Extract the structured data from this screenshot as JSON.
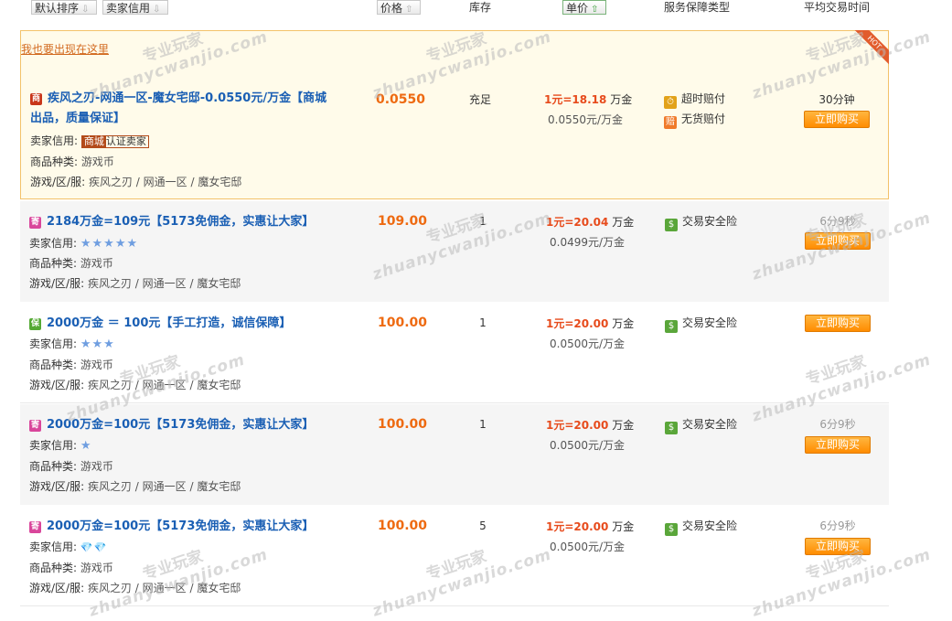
{
  "header": {
    "sort_default": "默认排序",
    "sort_credit": "卖家信用",
    "price": "价格",
    "stock": "库存",
    "unit_price": "单价",
    "service": "服务保障类型",
    "avg_time": "平均交易时间"
  },
  "hot_link": "我也要出现在这里",
  "hot_ribbon": "HOT",
  "watermark": {
    "cn": "专业玩家",
    "en": "zhuanycwanjio.com"
  },
  "labels": {
    "credit": "卖家信用:",
    "category": "商品种类:",
    "server": "游戏/区/服:"
  },
  "rows": [
    {
      "badge": "商",
      "title_line1": "疾风之刃-网通一区-魔女宅邸-0.0550元/万金【商城",
      "title_line2": "出品，质量保证】",
      "credit_cert_a": "商城",
      "credit_cert_b": "认证卖家",
      "category": "游戏币",
      "server": "疾风之刃 / 网通一区 / 魔女宅邸",
      "price": "0.0550",
      "stock": "充足",
      "unit_hi": "1元=18.18",
      "unit_suffix": "万金",
      "unit_sub": "0.0550元/万金",
      "service1": "超时赔付",
      "service2": "无货赔付",
      "time": "30分钟",
      "buy": "立即购买"
    },
    {
      "badge": "寄",
      "title": "2184万金=109元【5173免佣金，实惠让大家】",
      "stars": "★★★★★",
      "category": "游戏币",
      "server": "疾风之刃 / 网通一区 / 魔女宅邸",
      "price": "109.00",
      "stock": "1",
      "unit_hi": "1元=20.04",
      "unit_suffix": "万金",
      "unit_sub": "0.0499元/万金",
      "service1": "交易安全险",
      "time": "6分9秒",
      "buy": "立即购买"
    },
    {
      "badge": "保",
      "title": "2000万金 ＝ 100元【手工打造，诚信保障】",
      "stars": "★★★",
      "category": "游戏币",
      "server": "疾风之刃 / 网通一区 / 魔女宅邸",
      "price": "100.00",
      "stock": "1",
      "unit_hi": "1元=20.00",
      "unit_suffix": "万金",
      "unit_sub": "0.0500元/万金",
      "service1": "交易安全险",
      "buy": "立即购买"
    },
    {
      "badge": "寄",
      "title": "2000万金=100元【5173免佣金，实惠让大家】",
      "stars": "★",
      "category": "游戏币",
      "server": "疾风之刃 / 网通一区 / 魔女宅邸",
      "price": "100.00",
      "stock": "1",
      "unit_hi": "1元=20.00",
      "unit_suffix": "万金",
      "unit_sub": "0.0500元/万金",
      "service1": "交易安全险",
      "time": "6分9秒",
      "buy": "立即购买"
    },
    {
      "badge": "寄",
      "title": "2000万金=100元【5173免佣金，实惠让大家】",
      "diamonds": "💎💎",
      "category": "游戏币",
      "server": "疾风之刃 / 网通一区 / 魔女宅邸",
      "price": "100.00",
      "stock": "5",
      "unit_hi": "1元=20.00",
      "unit_suffix": "万金",
      "unit_sub": "0.0500元/万金",
      "service1": "交易安全险",
      "time": "6分9秒",
      "buy": "立即购买"
    }
  ]
}
